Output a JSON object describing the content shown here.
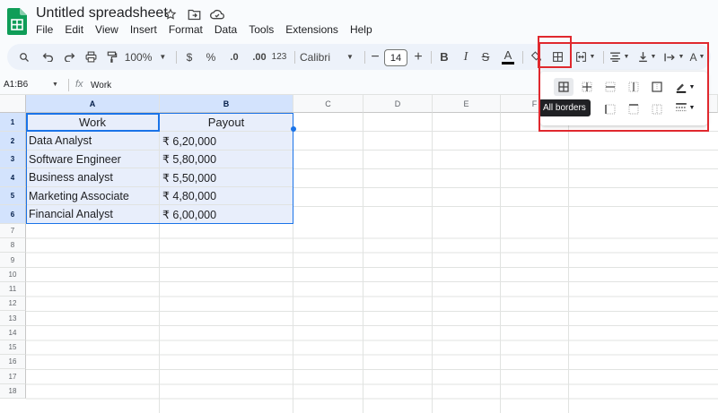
{
  "app": {
    "title": "Untitled spreadsheet"
  },
  "menu": [
    "File",
    "Edit",
    "View",
    "Insert",
    "Format",
    "Data",
    "Tools",
    "Extensions",
    "Help"
  ],
  "toolbar": {
    "zoom": "100%",
    "currency": "$",
    "percent": "%",
    "decimal_decrease": ".0",
    "decimal_increase": ".00",
    "more_formats": "123",
    "font": "Calibri",
    "font_size": "14",
    "bold": "B",
    "italic": "I",
    "strikethrough": "S",
    "text_color": "A",
    "text_rotation": "A"
  },
  "formula_bar": {
    "name_box": "A1:B6",
    "fx": "fx",
    "value": "Work"
  },
  "columns": [
    "A",
    "B",
    "C",
    "D",
    "E",
    "F",
    "G"
  ],
  "rows": [
    "1",
    "2",
    "3",
    "4",
    "5",
    "6",
    "7",
    "8",
    "9",
    "10",
    "11",
    "12",
    "13",
    "14",
    "15",
    "16",
    "17",
    "18"
  ],
  "cells": {
    "header": [
      "Work",
      "Payout"
    ],
    "data": [
      [
        "Data Analyst",
        "₹ 6,20,000"
      ],
      [
        "Software Engineer",
        "₹ 5,80,000"
      ],
      [
        "Business analyst",
        "₹ 5,50,000"
      ],
      [
        "Marketing Associate",
        "₹ 4,80,000"
      ],
      [
        "Financial Analyst",
        "₹ 6,00,000"
      ]
    ]
  },
  "borders_menu": {
    "tooltip": "All borders"
  },
  "colors": {
    "accent": "#1a73e8",
    "selection": "#e8eefb",
    "highlight_box": "#e0282e",
    "sheets_green": "#0f9d58"
  }
}
